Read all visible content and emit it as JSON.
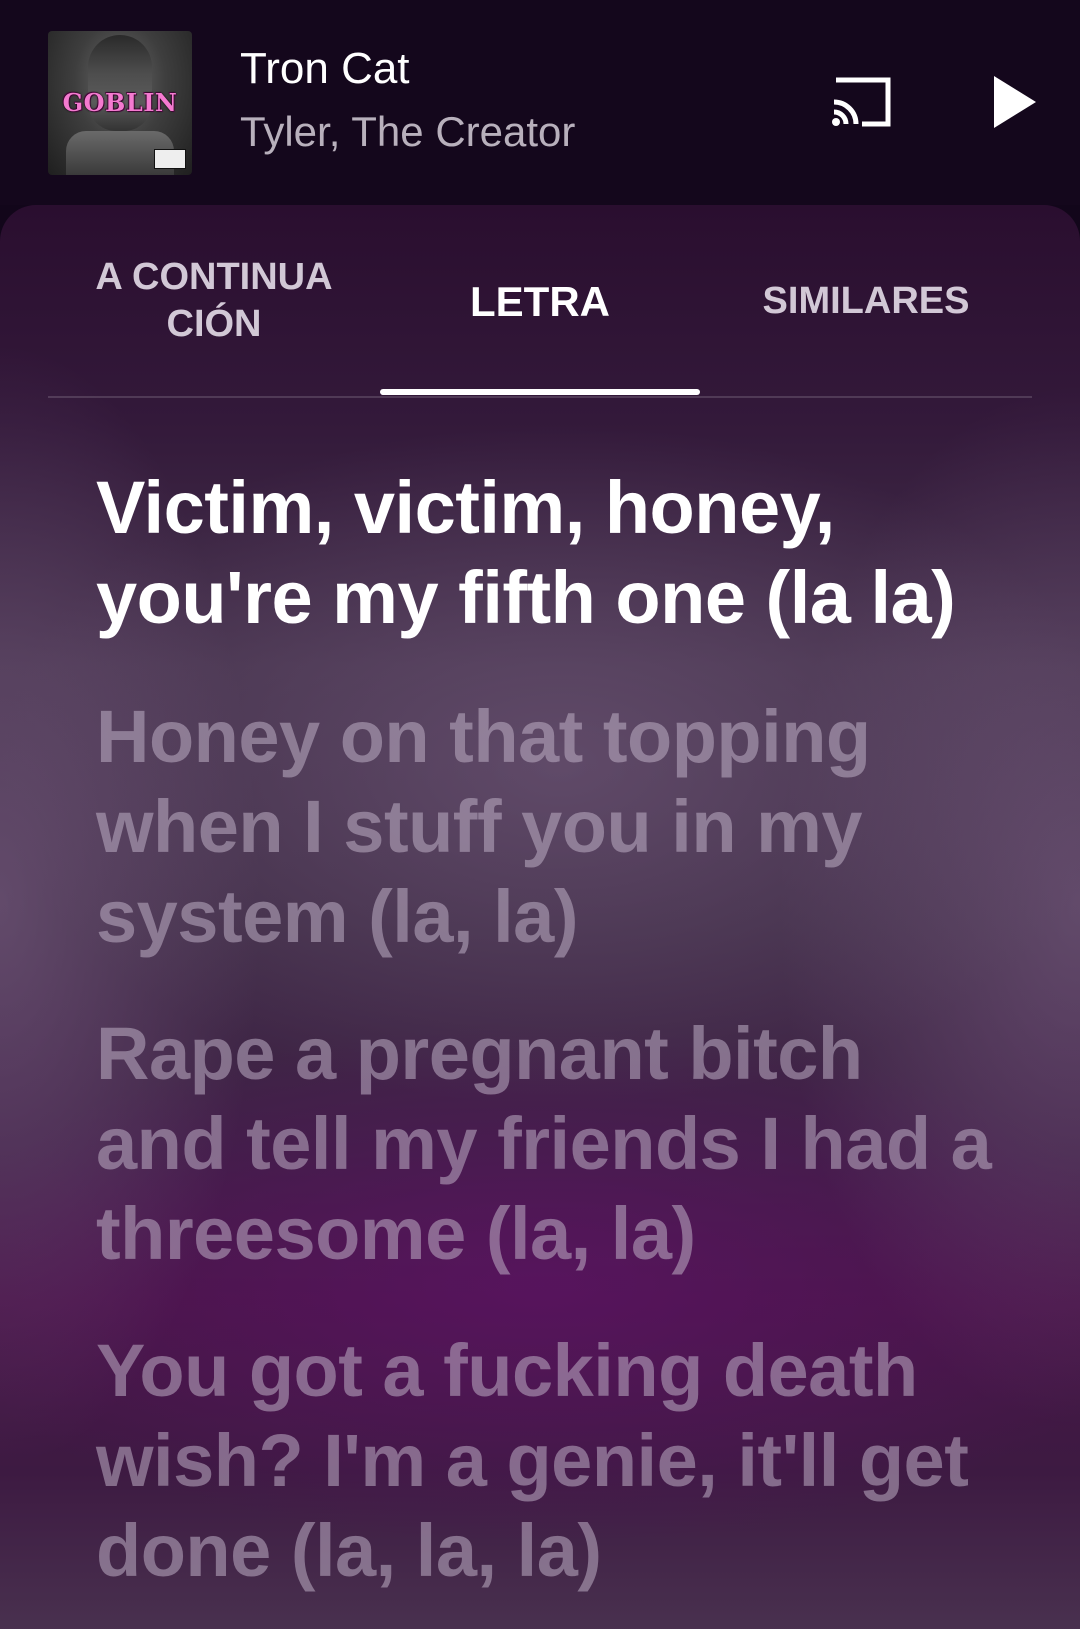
{
  "now_playing": {
    "album_art_text": "GOBLIN",
    "title": "Tron Cat",
    "artist": "Tyler, The Creator",
    "cast_icon": "cast-icon",
    "play_icon": "play-icon"
  },
  "tabs": [
    {
      "label": "A CONTINUA CIÓN",
      "selected": false
    },
    {
      "label": "LETRA",
      "selected": true
    },
    {
      "label": "SIMILARES",
      "selected": false
    }
  ],
  "lyrics": [
    {
      "text": "Victim, victim, honey, you're my fifth one (la la)",
      "active": true
    },
    {
      "text": "Honey on that topping when I stuff you in my system (la, la)",
      "active": false
    },
    {
      "text": "Rape a pregnant bitch and tell my friends I had a threesome (la, la)",
      "active": false
    },
    {
      "text": "You got a fucking death wish? I'm a genie, it'll get done (la, la, la)",
      "active": false
    }
  ]
}
